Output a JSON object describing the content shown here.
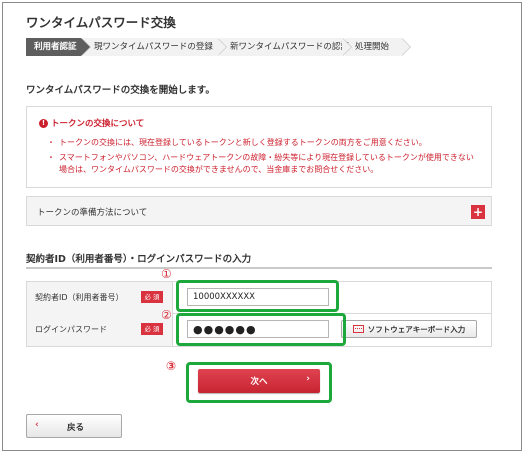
{
  "page": {
    "title": "ワンタイムパスワード交換",
    "start_text": "ワンタイムパスワードの交換を開始します。"
  },
  "steps": [
    {
      "label": "利用者認証",
      "active": true
    },
    {
      "label": "現ワンタイムパスワードの登録",
      "active": false
    },
    {
      "label": "新ワンタイムパスワードの認証",
      "active": false
    },
    {
      "label": "処理開始",
      "active": false
    }
  ],
  "notice": {
    "heading": "トークンの交換について",
    "items": [
      "トークンの交換には、現在登録しているトークンと新しく登録するトークンの両方をご用意ください。",
      "スマートフォンやパソコン、ハードウェアトークンの故障・紛失等により現在登録しているトークンが使用できない場合は、ワンタイムパスワードの交換ができませんので、当金庫までお問合せください。"
    ]
  },
  "prep": {
    "label": "トークンの準備方法について",
    "expand_icon": "+"
  },
  "login_section": {
    "title": "契約者ID（利用者番号）・ログインパスワードの入力",
    "required_badge": "必 須",
    "fields": {
      "contract_id": {
        "label": "契約者ID（利用者番号）",
        "value": "10000XXXXXX"
      },
      "password": {
        "label": "ログインパスワード",
        "value": "●●●●●●"
      }
    },
    "software_keyboard_label": "ソフトウェアキーボード入力"
  },
  "annotations": {
    "n1": "①",
    "n2": "②",
    "n3": "③",
    "highlight_color": "#1ca83a"
  },
  "buttons": {
    "next": "次へ",
    "next_arrow": "›",
    "back": "戻る",
    "back_arrow": "‹"
  },
  "colors": {
    "accent": "#d9333f",
    "warning_text": "#cc1f2c",
    "active_step": "#5e5e5e"
  }
}
